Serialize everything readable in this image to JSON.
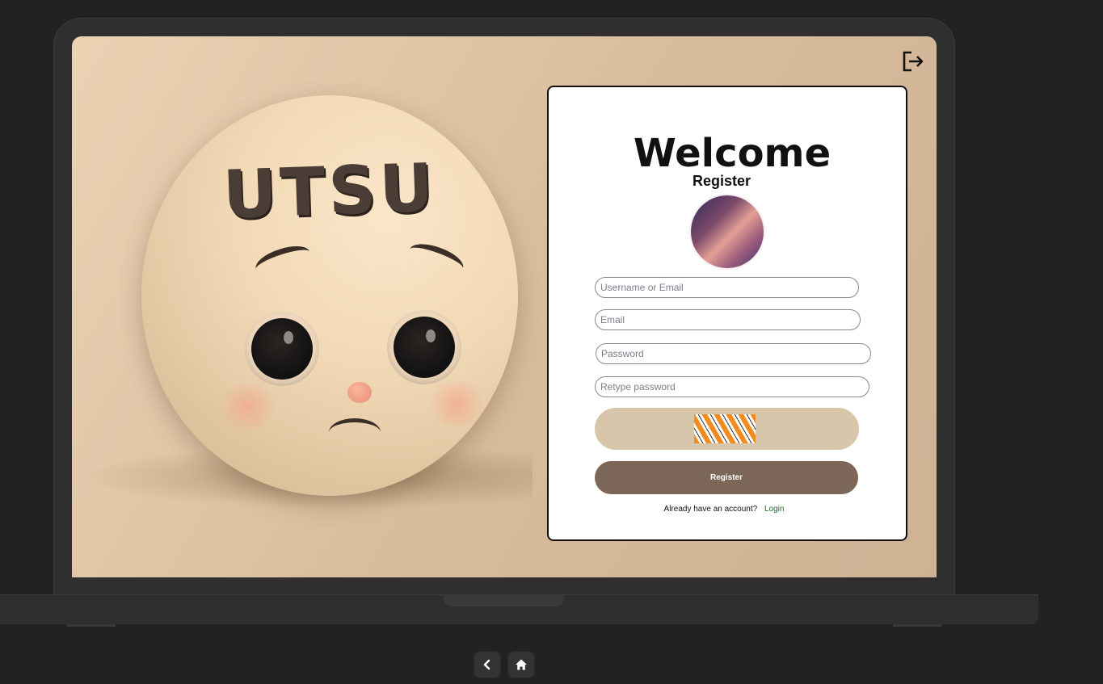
{
  "illustration": {
    "ball_text": "UTSU"
  },
  "form": {
    "title": "Welcome",
    "subtitle": "Register",
    "fields": {
      "username_placeholder": "Username or Email",
      "email_placeholder": "Email",
      "password_placeholder": "Password",
      "retype_placeholder": "Retype password"
    },
    "register_label": "Register",
    "login_prompt": "Already have an account?",
    "login_link": "Login"
  },
  "icons": {
    "logout": "logout-icon",
    "back": "chevron-left-icon",
    "home": "home-icon"
  },
  "colors": {
    "register_button": "#7b6658",
    "captcha_bg": "#d8c6aa",
    "login_link": "#1f6a2a",
    "page_bg": "#222222"
  }
}
